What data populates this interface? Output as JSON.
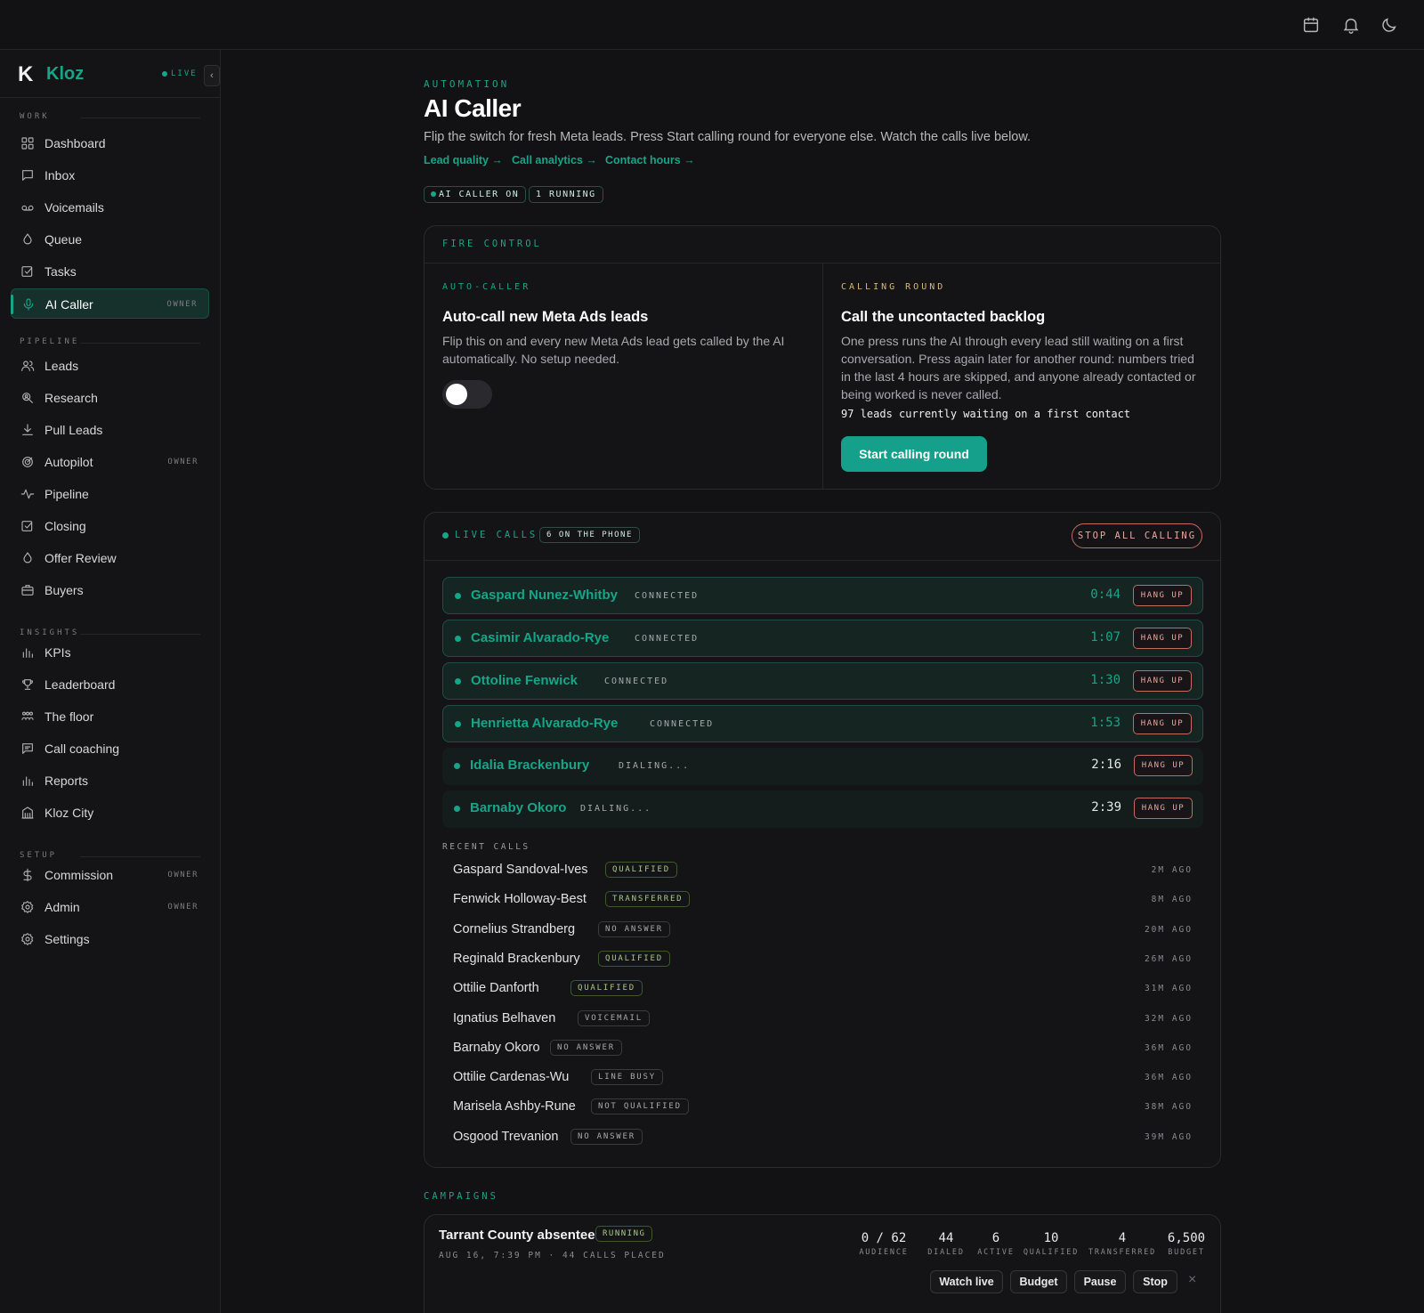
{
  "topbar": {
    "icons": [
      "calendar-icon",
      "bell-icon",
      "moon-icon"
    ]
  },
  "brand": {
    "logo_letter": "K",
    "name": "Kloz",
    "status": "LIVE",
    "collapse_glyph": "‹"
  },
  "sidebar": {
    "sections": {
      "work": "WORK",
      "pipeline": "PIPELINE",
      "insights": "INSIGHTS",
      "setup": "SETUP"
    },
    "items": [
      {
        "label": "Dashboard",
        "icon": "grid-icon",
        "badge": ""
      },
      {
        "label": "Inbox",
        "icon": "message-icon",
        "badge": ""
      },
      {
        "label": "Voicemails",
        "icon": "voicemail-icon",
        "badge": ""
      },
      {
        "label": "Queue",
        "icon": "drop-icon",
        "badge": ""
      },
      {
        "label": "Tasks",
        "icon": "checkbox-icon",
        "badge": ""
      },
      {
        "label": "AI Caller",
        "icon": "mic-icon",
        "badge": "OWNER"
      },
      {
        "label": "Leads",
        "icon": "users-icon",
        "badge": ""
      },
      {
        "label": "Research",
        "icon": "search-person-icon",
        "badge": ""
      },
      {
        "label": "Pull Leads",
        "icon": "download-icon",
        "badge": ""
      },
      {
        "label": "Autopilot",
        "icon": "target-icon",
        "badge": "OWNER"
      },
      {
        "label": "Pipeline",
        "icon": "activity-icon",
        "badge": ""
      },
      {
        "label": "Closing",
        "icon": "checkbox-icon",
        "badge": ""
      },
      {
        "label": "Offer Review",
        "icon": "drop-icon",
        "badge": ""
      },
      {
        "label": "Buyers",
        "icon": "briefcase-icon",
        "badge": ""
      },
      {
        "label": "KPIs",
        "icon": "bar-chart-icon",
        "badge": ""
      },
      {
        "label": "Leaderboard",
        "icon": "trophy-icon",
        "badge": ""
      },
      {
        "label": "The floor",
        "icon": "team-icon",
        "badge": ""
      },
      {
        "label": "Call coaching",
        "icon": "chat-lines-icon",
        "badge": ""
      },
      {
        "label": "Reports",
        "icon": "bar-chart-icon",
        "badge": ""
      },
      {
        "label": "Kloz City",
        "icon": "building-icon",
        "badge": ""
      },
      {
        "label": "Commission",
        "icon": "dollar-icon",
        "badge": "OWNER"
      },
      {
        "label": "Admin",
        "icon": "gear-icon",
        "badge": "OWNER"
      },
      {
        "label": "Settings",
        "icon": "gear-icon",
        "badge": ""
      }
    ]
  },
  "header": {
    "eyebrow": "AUTOMATION",
    "title": "AI Caller",
    "subtitle": "Flip the switch for fresh Meta leads. Press Start calling round for everyone else. Watch the calls live below.",
    "links": [
      "Lead quality →",
      "Call analytics →",
      "Contact hours →"
    ],
    "chips": [
      "AI CALLER ON",
      "1 RUNNING"
    ]
  },
  "fire_control": {
    "label": "FIRE CONTROL",
    "auto": {
      "eyebrow": "AUTO-CALLER",
      "title": "Auto-call new Meta Ads leads",
      "body": "Flip this on and every new Meta Ads lead gets called by the AI automatically. No setup needed.",
      "toggle_on": false
    },
    "round": {
      "eyebrow": "CALLING ROUND",
      "title": "Call the uncontacted backlog",
      "body": "One press runs the AI through every lead still waiting on a first conversation. Press again later for another round: numbers tried in the last 4 hours are skipped, and anyone already contacted or being worked is never called.",
      "waiting": "97 leads currently waiting on a first contact",
      "button": "Start calling round"
    }
  },
  "live_calls": {
    "label": "LIVE CALLS",
    "count_chip": "6 ON THE PHONE",
    "stop_button": "STOP ALL CALLING",
    "hang_label": "HANG UP",
    "calls": [
      {
        "name": "Gaspard Nunez-Whitby",
        "state": "CONNECTED",
        "time": "0:44",
        "connected": true
      },
      {
        "name": "Casimir Alvarado-Rye",
        "state": "CONNECTED",
        "time": "1:07",
        "connected": true
      },
      {
        "name": "Ottoline Fenwick",
        "state": "CONNECTED",
        "time": "1:30",
        "connected": true
      },
      {
        "name": "Henrietta Alvarado-Rye",
        "state": "CONNECTED",
        "time": "1:53",
        "connected": true
      },
      {
        "name": "Idalia Brackenbury",
        "state": "DIALING...",
        "time": "2:16",
        "connected": false
      },
      {
        "name": "Barnaby Okoro",
        "state": "DIALING...",
        "time": "2:39",
        "connected": false
      }
    ],
    "recent_label": "RECENT CALLS",
    "recent": [
      {
        "name": "Gaspard Sandoval-Ives",
        "status": "QUALIFIED",
        "ago": "2M AGO",
        "green": true
      },
      {
        "name": "Fenwick Holloway-Best",
        "status": "TRANSFERRED",
        "ago": "8M AGO",
        "green": true
      },
      {
        "name": "Cornelius Strandberg",
        "status": "NO ANSWER",
        "ago": "20M AGO",
        "green": false
      },
      {
        "name": "Reginald Brackenbury",
        "status": "QUALIFIED",
        "ago": "26M AGO",
        "green": true
      },
      {
        "name": "Ottilie Danforth",
        "status": "QUALIFIED",
        "ago": "31M AGO",
        "green": true
      },
      {
        "name": "Ignatius Belhaven",
        "status": "VOICEMAIL",
        "ago": "32M AGO",
        "green": false
      },
      {
        "name": "Barnaby Okoro",
        "status": "NO ANSWER",
        "ago": "36M AGO",
        "green": false
      },
      {
        "name": "Ottilie Cardenas-Wu",
        "status": "LINE BUSY",
        "ago": "36M AGO",
        "green": false
      },
      {
        "name": "Marisela Ashby-Rune",
        "status": "NOT QUALIFIED",
        "ago": "38M AGO",
        "green": false
      },
      {
        "name": "Osgood Trevanion",
        "status": "NO ANSWER",
        "ago": "39M AGO",
        "green": false
      }
    ]
  },
  "campaigns": {
    "label": "CAMPAIGNS",
    "items": [
      {
        "name": "Tarrant County absentee",
        "status": "RUNNING",
        "meta": "AUG 16, 7:39 PM · 44 CALLS PLACED",
        "stats": [
          {
            "value": "0 / 62",
            "label": "AUDIENCE"
          },
          {
            "value": "44",
            "label": "DIALED"
          },
          {
            "value": "6",
            "label": "ACTIVE"
          },
          {
            "value": "10",
            "label": "QUALIFIED"
          },
          {
            "value": "4",
            "label": "TRANSFERRED"
          },
          {
            "value": "6,500",
            "label": "BUDGET"
          }
        ],
        "actions": [
          "Watch live",
          "Budget",
          "Pause",
          "Stop"
        ],
        "dismiss": "×"
      }
    ]
  }
}
